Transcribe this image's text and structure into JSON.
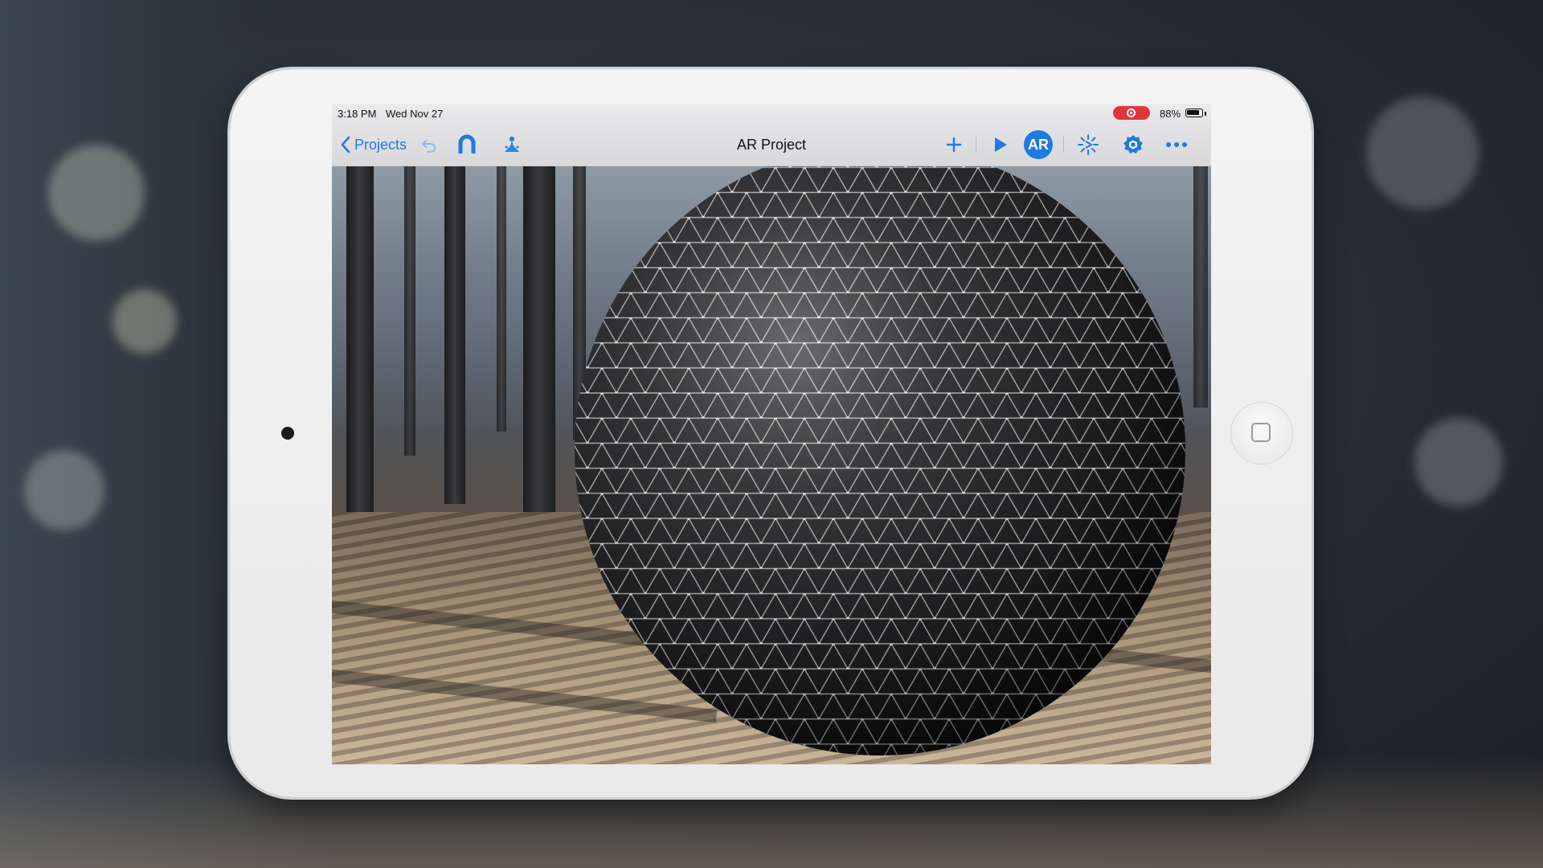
{
  "status_bar": {
    "time": "3:18 PM",
    "date": "Wed Nov 27",
    "battery_percent": "88%",
    "battery_level": 0.88,
    "recording": true
  },
  "toolbar": {
    "back_label": "Projects",
    "title": "AR Project",
    "icons": [
      "undo-icon",
      "magnet-icon",
      "physics-icon",
      "add-icon",
      "play-icon",
      "ar-icon",
      "anchor-icon",
      "settings-icon",
      "more-icon"
    ],
    "ar_label": "AR"
  },
  "colors": {
    "accent": "#1f7ae0",
    "record": "#e0353a",
    "sphere": "#2b2b2d",
    "wireframe": "#ffffff"
  }
}
